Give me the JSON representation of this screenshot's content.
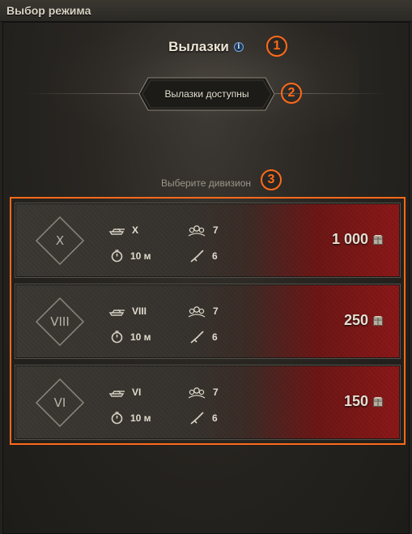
{
  "window": {
    "title": "Выбор режима"
  },
  "mode": {
    "title": "Вылазки",
    "info_icon": "info-icon"
  },
  "status": {
    "label": "Вылазки доступны"
  },
  "prompt": {
    "label": "Выберите дивизион"
  },
  "annotations": [
    "1",
    "2",
    "3"
  ],
  "colors": {
    "accent": "#ff6a1a",
    "reward_red": "#8a1616"
  },
  "divisions": [
    {
      "tier": "X",
      "vehicle_tier": "X",
      "players": "7",
      "duration": "10 м",
      "weapons": "6",
      "reward": "1 000",
      "reward_icon": "crate-icon"
    },
    {
      "tier": "VIII",
      "vehicle_tier": "VIII",
      "players": "7",
      "duration": "10 м",
      "weapons": "6",
      "reward": "250",
      "reward_icon": "crate-icon"
    },
    {
      "tier": "VI",
      "vehicle_tier": "VI",
      "players": "7",
      "duration": "10 м",
      "weapons": "6",
      "reward": "150",
      "reward_icon": "crate-icon"
    }
  ]
}
